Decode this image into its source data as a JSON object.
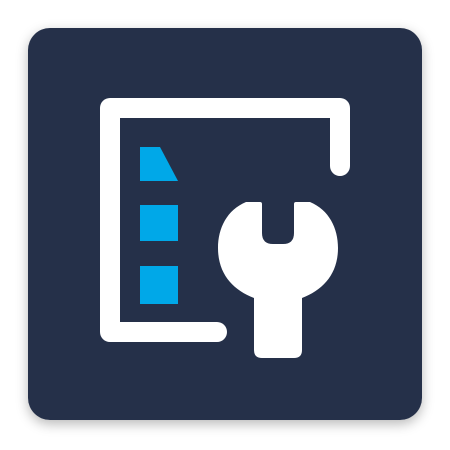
{
  "app_icon": {
    "icon_name": "document-settings-wrench-icon",
    "colors": {
      "background": "#253049",
      "foreground": "#ffffff",
      "accent": "#00a8e8",
      "page_background": "#ffffff"
    }
  }
}
